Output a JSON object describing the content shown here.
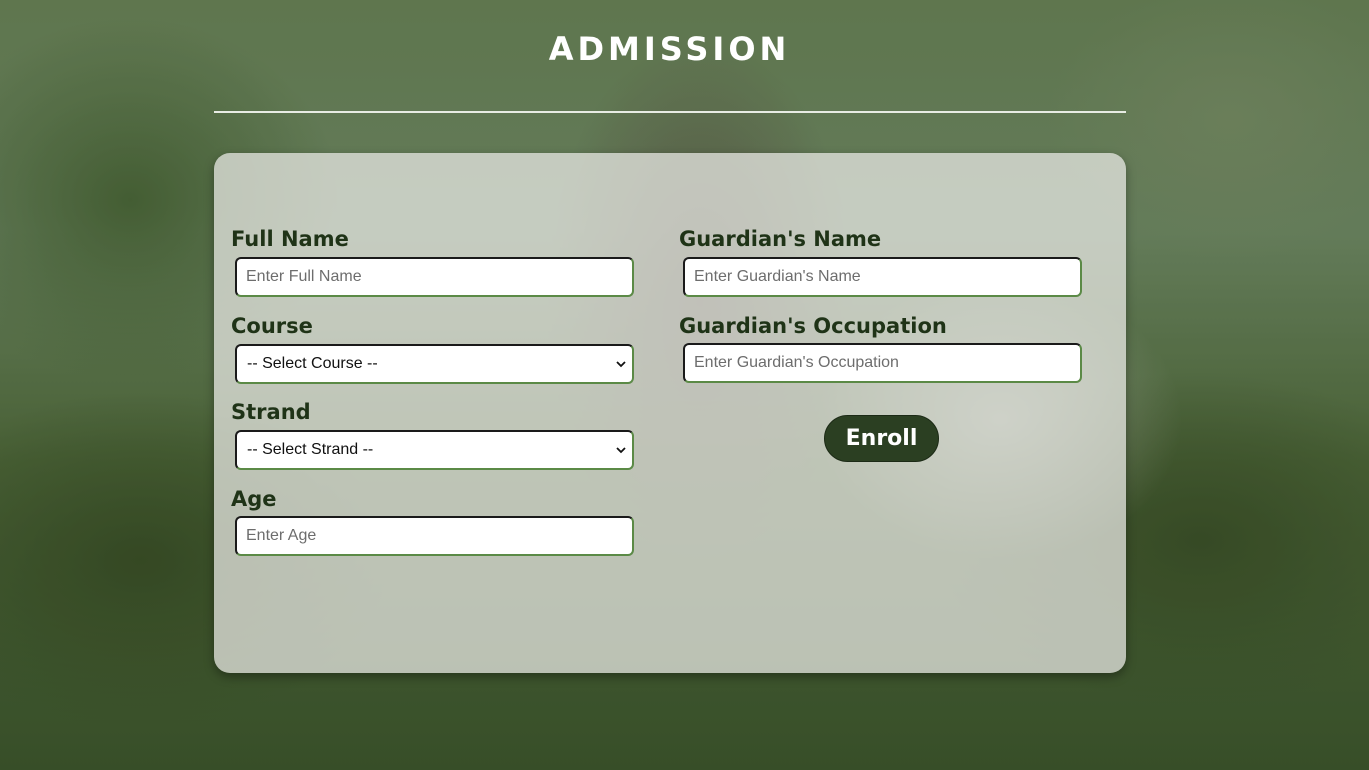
{
  "page": {
    "title": "ADMISSION"
  },
  "form": {
    "full_name": {
      "label": "Full Name",
      "placeholder": "Enter Full Name",
      "value": ""
    },
    "course": {
      "label": "Course",
      "selected": "-- Select Course --"
    },
    "strand": {
      "label": "Strand",
      "selected": "-- Select Strand --"
    },
    "age": {
      "label": "Age",
      "placeholder": "Enter Age",
      "value": ""
    },
    "guardian_name": {
      "label": "Guardian's Name",
      "placeholder": "Enter Guardian's Name",
      "value": ""
    },
    "guardian_occupation": {
      "label": "Guardian's Occupation",
      "placeholder": "Enter Guardian's Occupation",
      "value": ""
    },
    "submit_label": "Enroll"
  },
  "icons": {
    "course_select": "chevron-down-icon",
    "strand_select": "chevron-down-icon"
  },
  "colors": {
    "accent": "#2b3f22",
    "label_text": "#1f3317",
    "title_text": "#ffffff",
    "card_background": "#e8e8e4"
  }
}
